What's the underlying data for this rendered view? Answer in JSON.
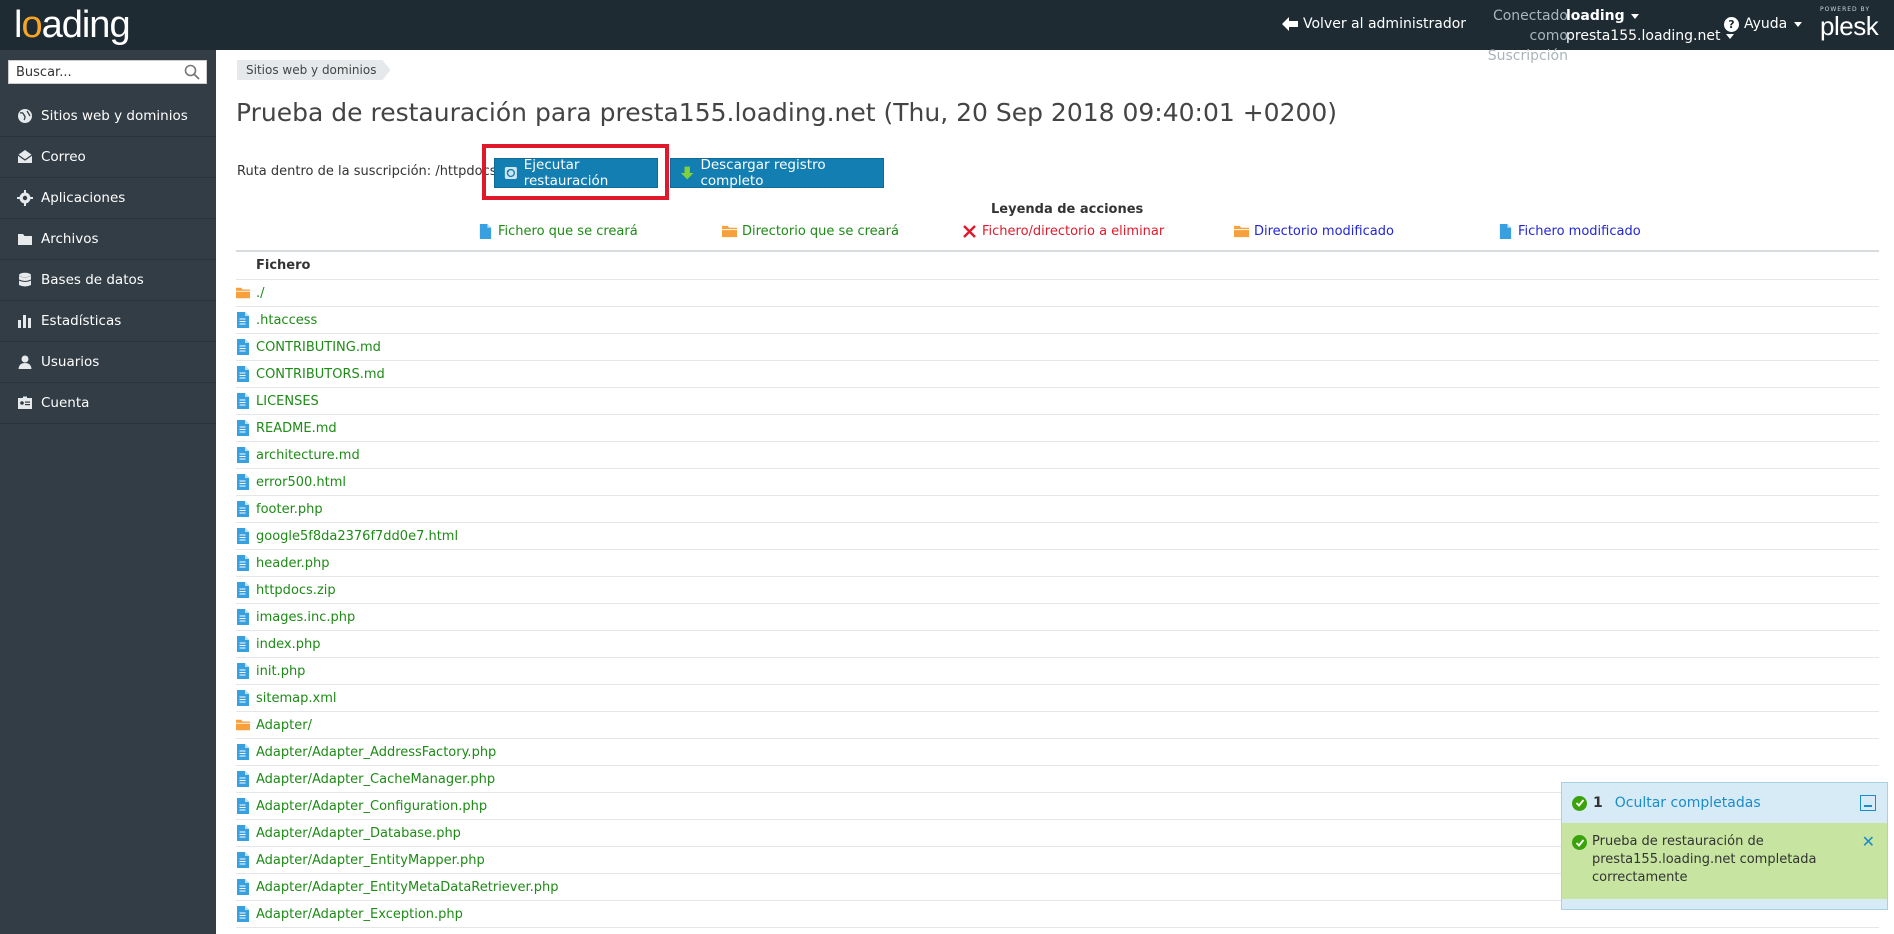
{
  "topbar": {
    "logo": "loading",
    "back_to_admin": "Volver al administrador",
    "connected_label": "Conectado como",
    "connected_value": "loading",
    "subscription_label": "Suscripción",
    "subscription_value": "presta155.loading.net",
    "help": "Ayuda",
    "powered_by": "POWERED BY",
    "brand": "plesk"
  },
  "sidebar": {
    "search_placeholder": "Buscar...",
    "items": [
      {
        "label": "Sitios web y dominios",
        "icon": "globe-icon"
      },
      {
        "label": "Correo",
        "icon": "mail-icon"
      },
      {
        "label": "Aplicaciones",
        "icon": "gear-icon"
      },
      {
        "label": "Archivos",
        "icon": "folder-icon"
      },
      {
        "label": "Bases de datos",
        "icon": "database-icon"
      },
      {
        "label": "Estadísticas",
        "icon": "bar-chart-icon"
      },
      {
        "label": "Usuarios",
        "icon": "user-icon"
      },
      {
        "label": "Cuenta",
        "icon": "account-card-icon"
      }
    ]
  },
  "main": {
    "breadcrumb": "Sitios web y dominios",
    "title": "Prueba de restauración para presta155.loading.net (Thu, 20 Sep 2018 09:40:01 +0200)",
    "path_label": "Ruta dentro de la suscripción: /httpdocs/",
    "restore_button": "Ejecutar restauración",
    "download_button": "Descargar registro completo",
    "legend_title": "Leyenda de acciones",
    "legend": {
      "file_created": "Fichero que se creará",
      "dir_created": "Directorio que se creará",
      "delete": "Fichero/directorio a eliminar",
      "dir_modified": "Directorio modificado",
      "file_modified": "Fichero modificado"
    },
    "column_header": "Fichero",
    "files": [
      {
        "name": "./",
        "type": "folder"
      },
      {
        "name": ".htaccess",
        "type": "file"
      },
      {
        "name": "CONTRIBUTING.md",
        "type": "file"
      },
      {
        "name": "CONTRIBUTORS.md",
        "type": "file"
      },
      {
        "name": "LICENSES",
        "type": "file"
      },
      {
        "name": "README.md",
        "type": "file"
      },
      {
        "name": "architecture.md",
        "type": "file"
      },
      {
        "name": "error500.html",
        "type": "file"
      },
      {
        "name": "footer.php",
        "type": "file"
      },
      {
        "name": "google5f8da2376f7dd0e7.html",
        "type": "file"
      },
      {
        "name": "header.php",
        "type": "file"
      },
      {
        "name": "httpdocs.zip",
        "type": "file"
      },
      {
        "name": "images.inc.php",
        "type": "file"
      },
      {
        "name": "index.php",
        "type": "file"
      },
      {
        "name": "init.php",
        "type": "file"
      },
      {
        "name": "sitemap.xml",
        "type": "file"
      },
      {
        "name": "Adapter/",
        "type": "folder"
      },
      {
        "name": "Adapter/Adapter_AddressFactory.php",
        "type": "file"
      },
      {
        "name": "Adapter/Adapter_CacheManager.php",
        "type": "file"
      },
      {
        "name": "Adapter/Adapter_Configuration.php",
        "type": "file"
      },
      {
        "name": "Adapter/Adapter_Database.php",
        "type": "file"
      },
      {
        "name": "Adapter/Adapter_EntityMapper.php",
        "type": "file"
      },
      {
        "name": "Adapter/Adapter_EntityMetaDataRetriever.php",
        "type": "file"
      },
      {
        "name": "Adapter/Adapter_Exception.php",
        "type": "file"
      }
    ]
  },
  "notifications": {
    "count": "1",
    "hide_completed": "Ocultar completadas",
    "message": "Prueba de restauración de presta155.loading.net completada correctamente"
  },
  "colors": {
    "topbar": "#1e2b33",
    "sidebar": "#333d45",
    "button": "#137eb1",
    "created": "#1d8b16",
    "delete": "#e0192a",
    "modified": "#2226d6",
    "highlight": "#e0192a"
  }
}
